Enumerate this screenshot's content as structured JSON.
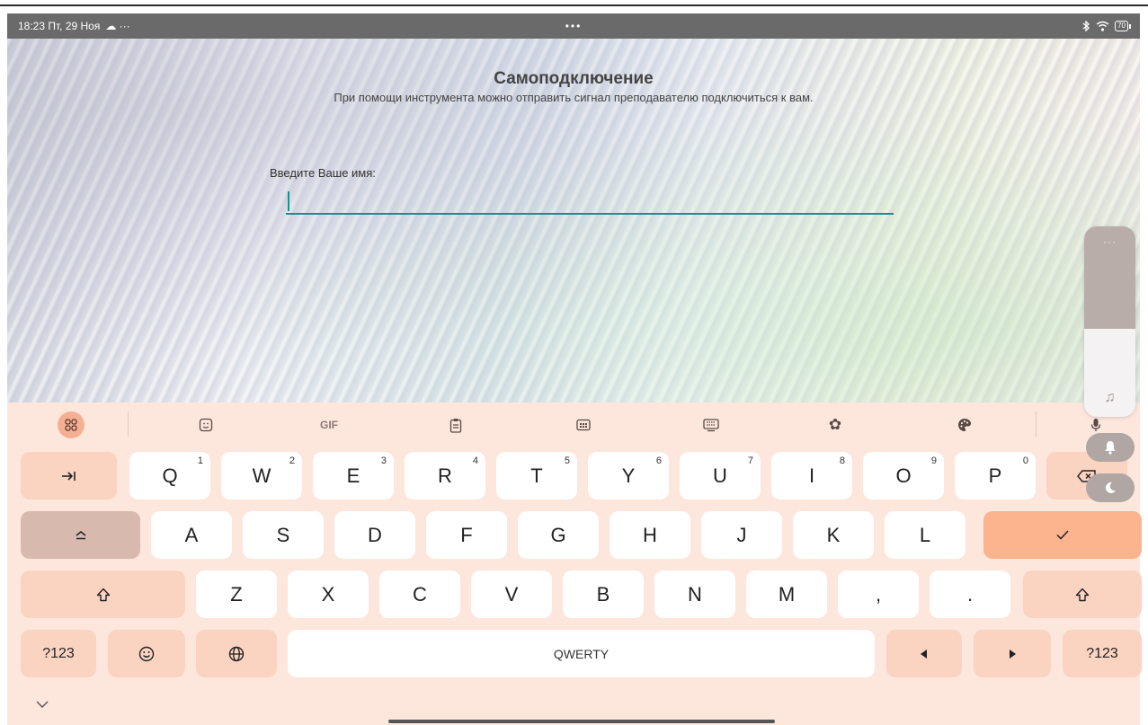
{
  "status_bar": {
    "time_date": "18:23 Пт, 29 Ноя",
    "left_icons": "☁ ···",
    "center_dots": "•••",
    "battery_level": "70"
  },
  "app": {
    "title": "Самоподключение",
    "subtitle": "При помощи инструмента можно отправить сигнал преподавателю подключиться к вам.",
    "name_label": "Введите Ваше имя:",
    "name_value": ""
  },
  "volume_panel": {
    "more_label": "···",
    "level": 0.46
  },
  "keyboard": {
    "toolbar": {
      "gif_label": "GIF"
    },
    "row1": [
      {
        "label": "Q",
        "hint": "1"
      },
      {
        "label": "W",
        "hint": "2"
      },
      {
        "label": "E",
        "hint": "3"
      },
      {
        "label": "R",
        "hint": "4"
      },
      {
        "label": "T",
        "hint": "5"
      },
      {
        "label": "Y",
        "hint": "6"
      },
      {
        "label": "U",
        "hint": "7"
      },
      {
        "label": "I",
        "hint": "8"
      },
      {
        "label": "O",
        "hint": "9"
      },
      {
        "label": "P",
        "hint": "0"
      }
    ],
    "row2": [
      "A",
      "S",
      "D",
      "F",
      "G",
      "H",
      "J",
      "K",
      "L"
    ],
    "row3": [
      "Z",
      "X",
      "C",
      "V",
      "B",
      "N",
      "M",
      ",",
      "."
    ],
    "symbols_label": "?123",
    "space_label": "QWERTY"
  }
}
